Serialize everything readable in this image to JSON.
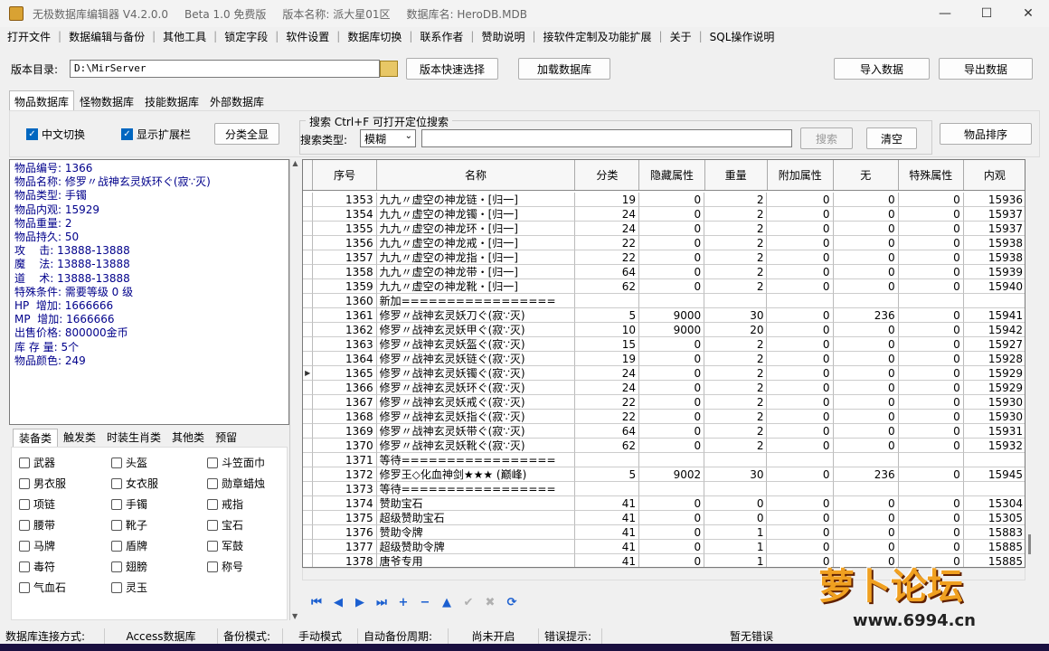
{
  "window": {
    "title_parts": [
      "无极数据库编辑器 V4.2.0.0",
      "Beta 1.0 免费版",
      "版本名称: 派大星01区",
      "数据库名: HeroDB.MDB"
    ],
    "controls": [
      "—",
      "☐",
      "✕"
    ]
  },
  "menu": [
    "打开文件",
    "数据编辑与备份",
    "其他工具",
    "锁定字段",
    "软件设置",
    "数据库切换",
    "联系作者",
    "赞助说明",
    "接软件定制及功能扩展",
    "关于",
    "SQL操作说明"
  ],
  "pathbar": {
    "label": "版本目录:",
    "value": "D:\\MirServer",
    "quick_select": "版本快速选择",
    "load_db": "加载数据库",
    "import": "导入数据",
    "export": "导出数据"
  },
  "tabs": [
    "物品数据库",
    "怪物数据库",
    "技能数据库",
    "外部数据库"
  ],
  "options": {
    "chinese_toggle": "中文切换",
    "show_ext": "显示扩展栏",
    "show_all": "分类全显",
    "search_title": "搜索   Ctrl+F 可打开定位搜索",
    "search_type_label": "搜索类型:",
    "search_type_value": "模糊",
    "search_input": "",
    "search_btn": "搜索",
    "clear_btn": "清空",
    "sort_btn": "物品排序"
  },
  "info": [
    "物品编号: 1366",
    "物品名称: 修罗〃战神玄灵妖环ぐ(寂∵灭)",
    "物品类型: 手镯",
    "物品内观: 15929",
    "物品重量: 2",
    "物品持久: 50",
    "攻    击: 13888-13888",
    "魔    法: 13888-13888",
    "道    术: 13888-13888",
    "特殊条件: 需要等级 0 级",
    "HP  增加: 1666666",
    "MP  增加: 1666666",
    "出售价格: 800000金币",
    "库 存 量: 5个",
    "物品颜色: 249"
  ],
  "category_tabs": [
    "装备类",
    "触发类",
    "时装生肖类",
    "其他类",
    "预留"
  ],
  "categories": [
    [
      "武器",
      "头盔",
      "斗笠面巾"
    ],
    [
      "男衣服",
      "女衣服",
      "勋章蜡烛"
    ],
    [
      "项链",
      "手镯",
      "戒指"
    ],
    [
      "腰带",
      "靴子",
      "宝石"
    ],
    [
      "马牌",
      "盾牌",
      "军鼓"
    ],
    [
      "毒符",
      "翅膀",
      "称号"
    ],
    [
      "气血石",
      "灵玉",
      ""
    ]
  ],
  "grid": {
    "headers": [
      "序号",
      "名称",
      "分类",
      "隐藏属性",
      "重量",
      "附加属性",
      "无",
      "特殊属性",
      "内观"
    ],
    "selected_row": 12,
    "rows": [
      [
        "1353",
        "九九〃虚空の神龙链・[归一]",
        "19",
        "0",
        "2",
        "0",
        "0",
        "0",
        "15936"
      ],
      [
        "1354",
        "九九〃虚空の神龙镯・[归一]",
        "24",
        "0",
        "2",
        "0",
        "0",
        "0",
        "15937"
      ],
      [
        "1355",
        "九九〃虚空の神龙环・[归一]",
        "24",
        "0",
        "2",
        "0",
        "0",
        "0",
        "15937"
      ],
      [
        "1356",
        "九九〃虚空の神龙戒・[归一]",
        "22",
        "0",
        "2",
        "0",
        "0",
        "0",
        "15938"
      ],
      [
        "1357",
        "九九〃虚空の神龙指・[归一]",
        "22",
        "0",
        "2",
        "0",
        "0",
        "0",
        "15938"
      ],
      [
        "1358",
        "九九〃虚空の神龙带・[归一]",
        "64",
        "0",
        "2",
        "0",
        "0",
        "0",
        "15939"
      ],
      [
        "1359",
        "九九〃虚空の神龙靴・[归一]",
        "62",
        "0",
        "2",
        "0",
        "0",
        "0",
        "15940"
      ],
      [
        "1360",
        "新加=================",
        "",
        "",
        "",
        "",
        "",
        "",
        ""
      ],
      [
        "1361",
        "修罗〃战神玄灵妖刀ぐ(寂∵灭)",
        "5",
        "9000",
        "30",
        "0",
        "236",
        "0",
        "15941"
      ],
      [
        "1362",
        "修罗〃战神玄灵妖甲ぐ(寂∵灭)",
        "10",
        "9000",
        "20",
        "0",
        "0",
        "0",
        "15942"
      ],
      [
        "1363",
        "修罗〃战神玄灵妖盔ぐ(寂∵灭)",
        "15",
        "0",
        "2",
        "0",
        "0",
        "0",
        "15927"
      ],
      [
        "1364",
        "修罗〃战神玄灵妖链ぐ(寂∵灭)",
        "19",
        "0",
        "2",
        "0",
        "0",
        "0",
        "15928"
      ],
      [
        "1365",
        "修罗〃战神玄灵妖镯ぐ(寂∵灭)",
        "24",
        "0",
        "2",
        "0",
        "0",
        "0",
        "15929"
      ],
      [
        "1366",
        "修罗〃战神玄灵妖环ぐ(寂∵灭)",
        "24",
        "0",
        "2",
        "0",
        "0",
        "0",
        "15929"
      ],
      [
        "1367",
        "修罗〃战神玄灵妖戒ぐ(寂∵灭)",
        "22",
        "0",
        "2",
        "0",
        "0",
        "0",
        "15930"
      ],
      [
        "1368",
        "修罗〃战神玄灵妖指ぐ(寂∵灭)",
        "22",
        "0",
        "2",
        "0",
        "0",
        "0",
        "15930"
      ],
      [
        "1369",
        "修罗〃战神玄灵妖带ぐ(寂∵灭)",
        "64",
        "0",
        "2",
        "0",
        "0",
        "0",
        "15931"
      ],
      [
        "1370",
        "修罗〃战神玄灵妖靴ぐ(寂∵灭)",
        "62",
        "0",
        "2",
        "0",
        "0",
        "0",
        "15932"
      ],
      [
        "1371",
        "等待=================",
        "",
        "",
        "",
        "",
        "",
        "",
        ""
      ],
      [
        "1372",
        "修罗王◇化血神剑★★★ (巅峰)",
        "5",
        "9002",
        "30",
        "0",
        "236",
        "0",
        "15945"
      ],
      [
        "1373",
        "等待=================",
        "",
        "",
        "",
        "",
        "",
        "",
        ""
      ],
      [
        "1374",
        "赞助宝石",
        "41",
        "0",
        "0",
        "0",
        "0",
        "0",
        "15304"
      ],
      [
        "1375",
        "超级赞助宝石",
        "41",
        "0",
        "0",
        "0",
        "0",
        "0",
        "15305"
      ],
      [
        "1376",
        "赞助令牌",
        "41",
        "0",
        "1",
        "0",
        "0",
        "0",
        "15883"
      ],
      [
        "1377",
        "超级赞助令牌",
        "41",
        "0",
        "1",
        "0",
        "0",
        "0",
        "15885"
      ],
      [
        "1378",
        "唐爷专用",
        "41",
        "0",
        "1",
        "0",
        "0",
        "0",
        "15885"
      ]
    ]
  },
  "nav_buttons": [
    {
      "icon": "first-record-icon",
      "glyph": "⏮"
    },
    {
      "icon": "prior-record-icon",
      "glyph": "◀"
    },
    {
      "icon": "next-record-icon",
      "glyph": "▶"
    },
    {
      "icon": "last-record-icon",
      "glyph": "⏭"
    },
    {
      "icon": "insert-record-icon",
      "glyph": "+"
    },
    {
      "icon": "delete-record-icon",
      "glyph": "−"
    },
    {
      "icon": "edit-record-icon",
      "glyph": "▲"
    },
    {
      "icon": "post-edit-icon",
      "glyph": "✔"
    },
    {
      "icon": "cancel-edit-icon",
      "glyph": "✖"
    },
    {
      "icon": "refresh-icon",
      "glyph": "⟳"
    }
  ],
  "status": {
    "conn_label": "数据库连接方式:",
    "conn_value": "Access数据库",
    "backup_label": "备份模式:",
    "backup_value": "手动模式",
    "auto_label": "自动备份周期:",
    "auto_value": "尚未开启",
    "err_label": "错误提示:",
    "err_value": "暂无错误"
  },
  "watermark": {
    "logo": "萝卜论坛",
    "url": "www.6994.cn"
  }
}
